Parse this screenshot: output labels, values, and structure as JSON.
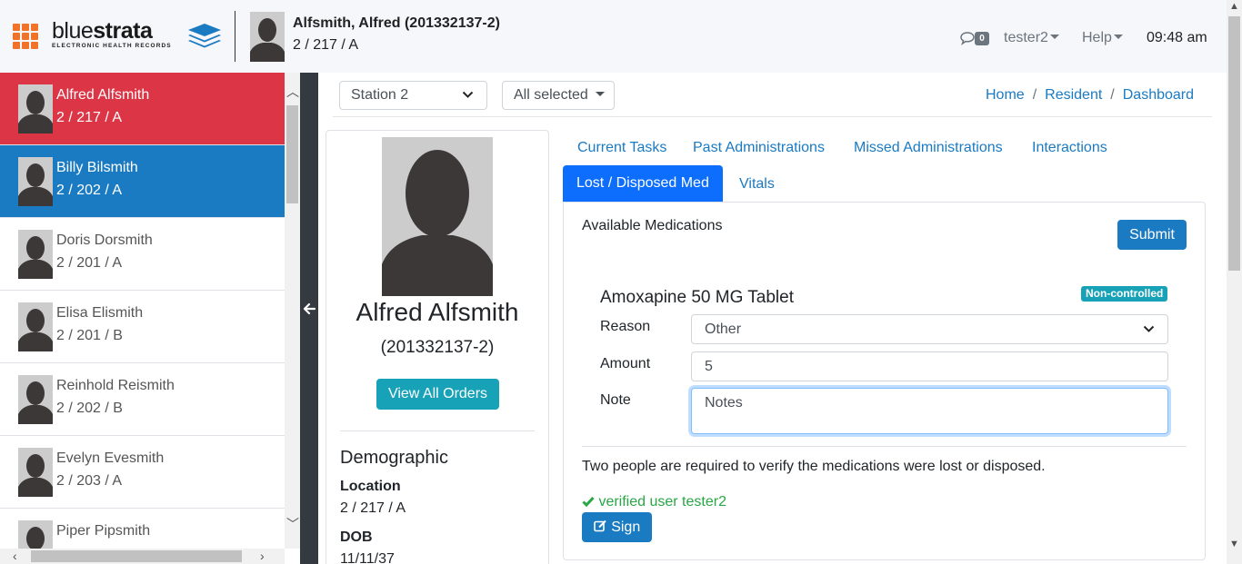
{
  "header": {
    "logo_text_light": "blue",
    "logo_text_bold": "strata",
    "logo_tagline": "ELECTRONIC HEALTH RECORDS",
    "patient_name": "Alfsmith, Alfred (201332137-2)",
    "patient_location": "2 / 217 / A",
    "message_count": "0",
    "user": "tester2",
    "help": "Help",
    "time": "09:48 am"
  },
  "sidebar": {
    "residents": [
      {
        "name": "Alfred Alfsmith",
        "location": "2 / 217 / A",
        "state": "selected-red"
      },
      {
        "name": "Billy Bilsmith",
        "location": "2 / 202 / A",
        "state": "selected-blue"
      },
      {
        "name": "Doris Dorsmith",
        "location": "2 / 201 / A",
        "state": "normal"
      },
      {
        "name": "Elisa Elismith",
        "location": "2 / 201 / B",
        "state": "normal"
      },
      {
        "name": "Reinhold Reismith",
        "location": "2 / 202 / B",
        "state": "normal"
      },
      {
        "name": "Evelyn Evesmith",
        "location": "2 / 203 / A",
        "state": "normal"
      },
      {
        "name": "Piper Pipsmith",
        "location": "",
        "state": "normal"
      }
    ]
  },
  "filters": {
    "station": "Station 2",
    "selection": "All selected"
  },
  "breadcrumb": {
    "home": "Home",
    "resident": "Resident",
    "dashboard": "Dashboard"
  },
  "profile": {
    "name": "Alfred Alfsmith",
    "id": "(201332137-2)",
    "view_orders": "View All Orders",
    "demographic_title": "Demographic",
    "location_label": "Location",
    "location_value": "2 / 217 / A",
    "dob_label": "DOB",
    "dob_value": "11/11/37"
  },
  "tabs": {
    "current_tasks": "Current Tasks",
    "past_administrations": "Past Administrations",
    "missed_administrations": "Missed Administrations",
    "interactions": "Interactions",
    "lost_disposed": "Lost / Disposed Med",
    "vitals": "Vitals"
  },
  "panel": {
    "available_label": "Available Medications",
    "submit": "Submit",
    "medication": "Amoxapine 50 MG Tablet",
    "badge": "Non-controlled",
    "reason_label": "Reason",
    "reason_value": "Other",
    "amount_label": "Amount",
    "amount_value": "5",
    "note_label": "Note",
    "note_placeholder": "Notes",
    "verify_note": "Two people are required to verify the medications were lost or disposed.",
    "verified_text": "verified user tester2",
    "sign": "Sign"
  },
  "colors": {
    "selected_red": "#dc3545",
    "selected_blue": "#1a7ac2",
    "link_blue": "#1a7ac2",
    "active_tab": "#0d6efd",
    "teal": "#17a2b8",
    "grid_orange": "#f0732a",
    "success_green": "#28a745"
  }
}
